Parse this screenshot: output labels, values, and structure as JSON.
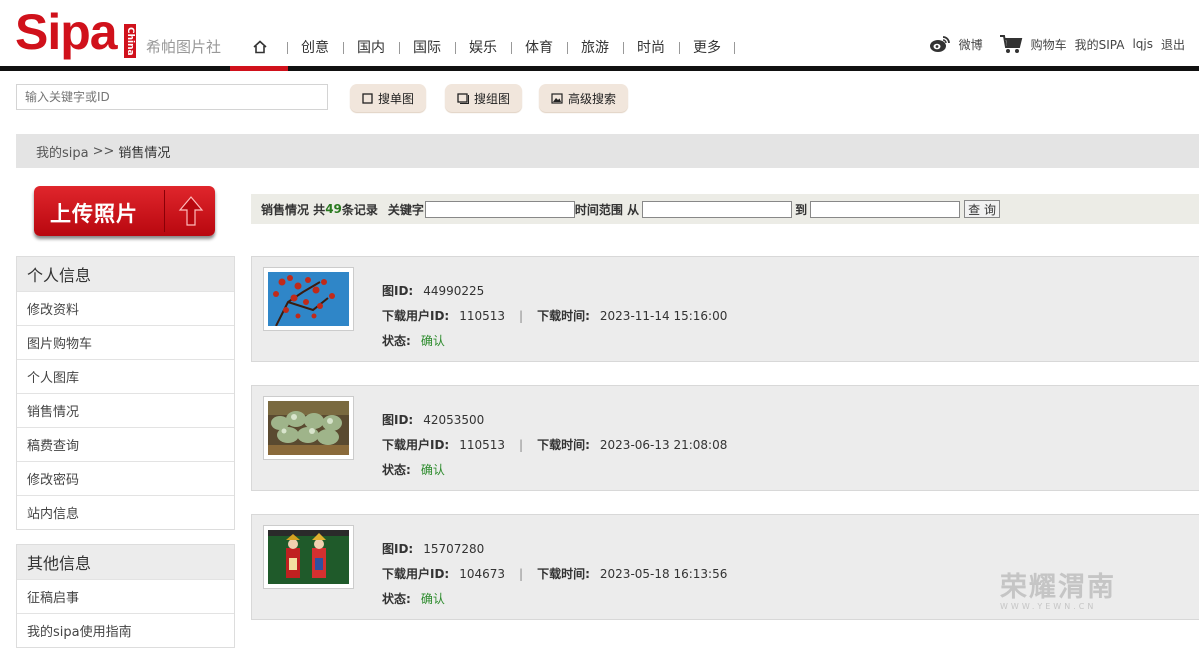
{
  "header": {
    "logo_text": "Sipa",
    "logo_tag": "China",
    "logo_cn": "希帕图片社",
    "nav": [
      "创意",
      "国内",
      "国际",
      "娱乐",
      "体育",
      "旅游",
      "时尚",
      "更多"
    ],
    "home_icon": "home-icon",
    "weibo_label": "微博",
    "cart_label": "购物车",
    "my_sipa": "我的SIPA",
    "username": "lqjs",
    "logout": "退出"
  },
  "search": {
    "placeholder": "输入关键字或ID",
    "btn_single": "搜单图",
    "btn_group": "搜组图",
    "btn_advanced": "高级搜索"
  },
  "breadcrumb": {
    "root": "我的sipa",
    "sep": ">>",
    "current": "销售情况"
  },
  "upload": {
    "label": "上传照片"
  },
  "sidebar": {
    "personal_title": "个人信息",
    "personal_items": [
      "修改资料",
      "图片购物车",
      "个人图库",
      "销售情况",
      "稿费查询",
      "修改密码",
      "站内信息"
    ],
    "other_title": "其他信息",
    "other_items": [
      "征稿启事",
      "我的sipa使用指南"
    ]
  },
  "filter": {
    "prefix": "销售情况 共 ",
    "count": "49",
    "suffix": "条记录",
    "keyword_label": "关键字",
    "range_label": "时间范围 从",
    "to_label": "到",
    "query_button": "查 询"
  },
  "labels": {
    "pic_id": "图ID:",
    "user_id": "下载用户ID:",
    "time": "下载时间:",
    "status": "状态:",
    "divider": "|"
  },
  "records": [
    {
      "pic_id": "44990225",
      "user_id": "110513",
      "time": "2023-11-14 15:16:00",
      "status": "确认"
    },
    {
      "pic_id": "42053500",
      "user_id": "110513",
      "time": "2023-06-13 21:08:08",
      "status": "确认"
    },
    {
      "pic_id": "15707280",
      "user_id": "104673",
      "time": "2023-05-18 16:13:56",
      "status": "确认"
    }
  ],
  "watermark": {
    "text": "荣耀渭南",
    "url": "WWW.YEWN.CN"
  },
  "colors": {
    "brand_red": "#d0111b",
    "status_green": "#2a8a2a",
    "count_green": "#2a7a20"
  }
}
